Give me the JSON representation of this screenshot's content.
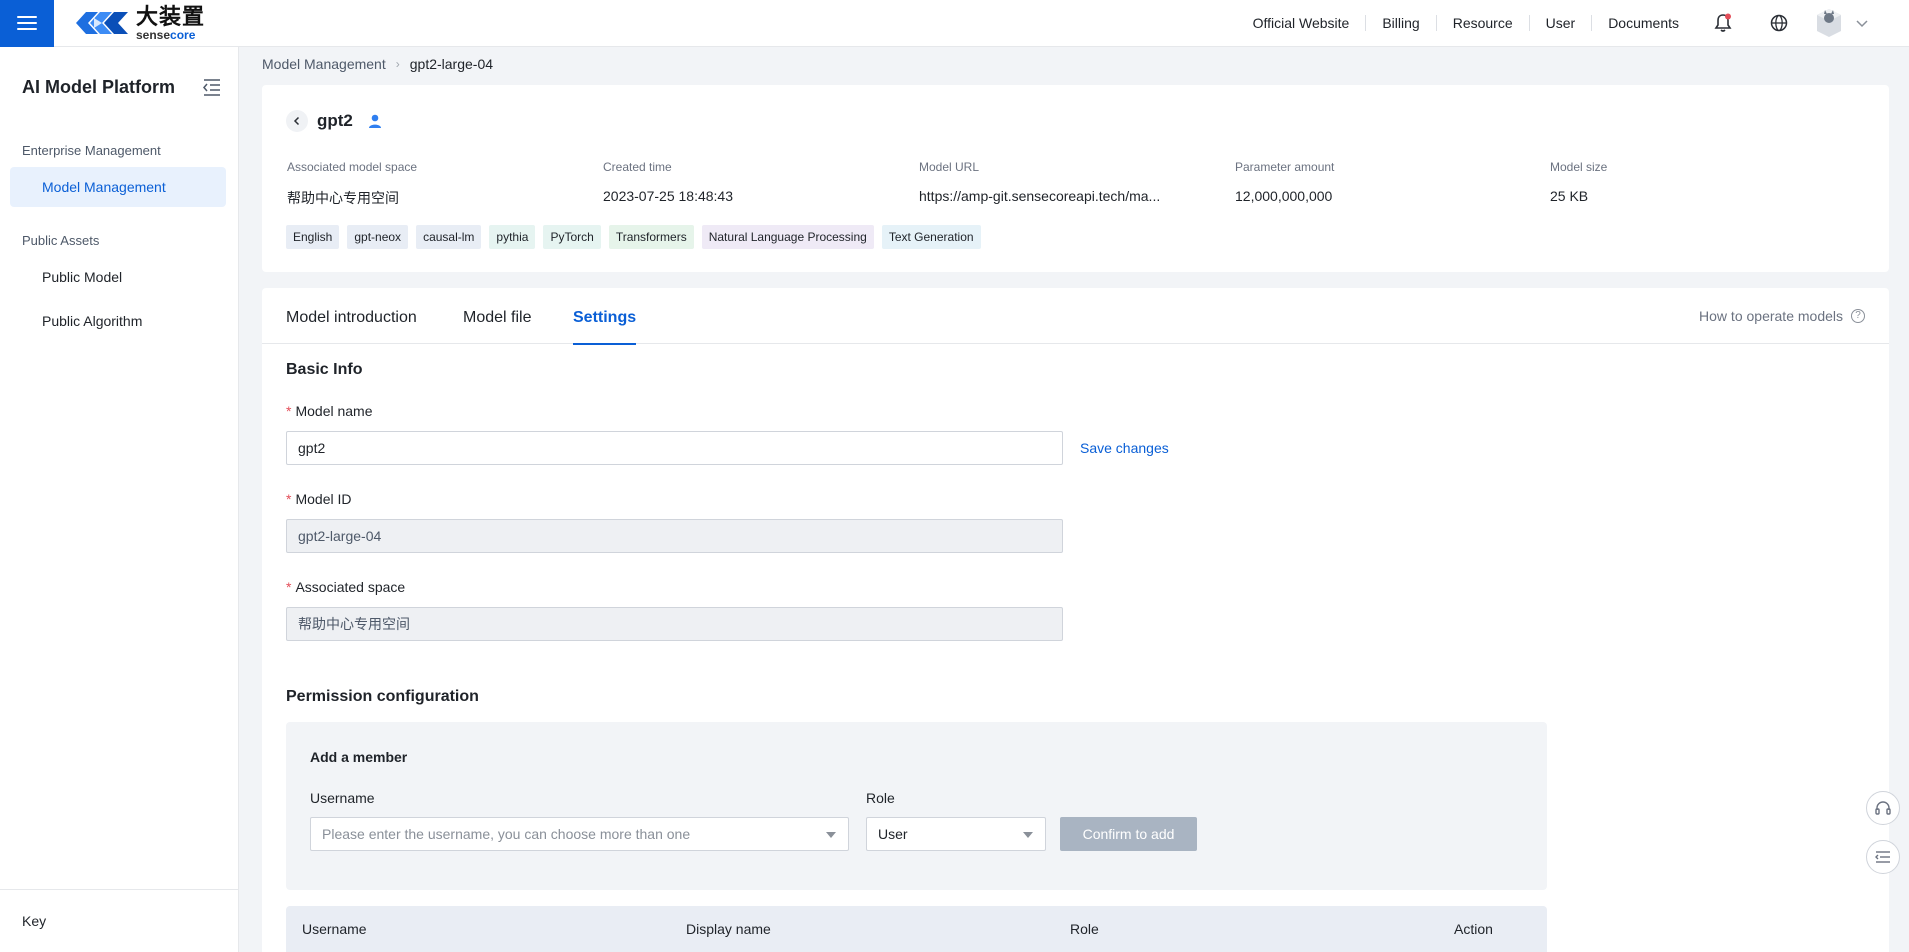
{
  "topbar": {
    "logo_cn": "大装置",
    "logo_en_a": "sense",
    "logo_en_b": "core",
    "nav": [
      "Official Website",
      "Billing",
      "Resource",
      "User",
      "Documents"
    ]
  },
  "sidebar": {
    "title": "AI Model Platform",
    "sections": [
      {
        "label": "Enterprise Management",
        "items": [
          {
            "label": "Model Management",
            "active": true
          }
        ]
      },
      {
        "label": "Public Assets",
        "items": [
          {
            "label": "Public Model"
          },
          {
            "label": "Public Algorithm"
          }
        ]
      }
    ],
    "bottom_label": "Key"
  },
  "breadcrumb": {
    "parent": "Model Management",
    "current": "gpt2-large-04"
  },
  "model": {
    "title": "gpt2",
    "meta": [
      {
        "label": "Associated model space",
        "value": "帮助中心专用空间"
      },
      {
        "label": "Created time",
        "value": "2023-07-25 18:48:43"
      },
      {
        "label": "Model URL",
        "value": "https://amp-git.sensecoreapi.tech/ma..."
      },
      {
        "label": "Parameter amount",
        "value": "12,000,000,000"
      },
      {
        "label": "Model size",
        "value": "25 KB"
      }
    ],
    "tags": [
      {
        "label": "English",
        "color": "#e8edf5"
      },
      {
        "label": "gpt-neox",
        "color": "#e8edf5"
      },
      {
        "label": "causal-lm",
        "color": "#e8edf5"
      },
      {
        "label": "pythia",
        "color": "#e6f4f1"
      },
      {
        "label": "PyTorch",
        "color": "#e6f4f1"
      },
      {
        "label": "Transformers",
        "color": "#e6f4ea"
      },
      {
        "label": "Natural Language Processing",
        "color": "#efeaf6"
      },
      {
        "label": "Text Generation",
        "color": "#e6f2f8"
      }
    ]
  },
  "tabs": {
    "items": [
      "Model introduction",
      "Model file",
      "Settings"
    ],
    "active": "Settings",
    "help": "How to operate models"
  },
  "settings": {
    "basic_title": "Basic Info",
    "model_name_label": "Model name",
    "model_name_value": "gpt2",
    "save_label": "Save changes",
    "model_id_label": "Model ID",
    "model_id_value": "gpt2-large-04",
    "space_label": "Associated space",
    "space_value": "帮助中心专用空间",
    "permission_title": "Permission configuration",
    "add_member_title": "Add a member",
    "username_label": "Username",
    "username_placeholder": "Please enter the username, you can choose more than one",
    "role_label": "Role",
    "role_value": "User",
    "confirm_label": "Confirm to add",
    "table_headers": [
      "Username",
      "Display name",
      "Role",
      "Action"
    ]
  },
  "colors": {
    "accent": "#0a5fd6",
    "required": "#e34d59"
  }
}
